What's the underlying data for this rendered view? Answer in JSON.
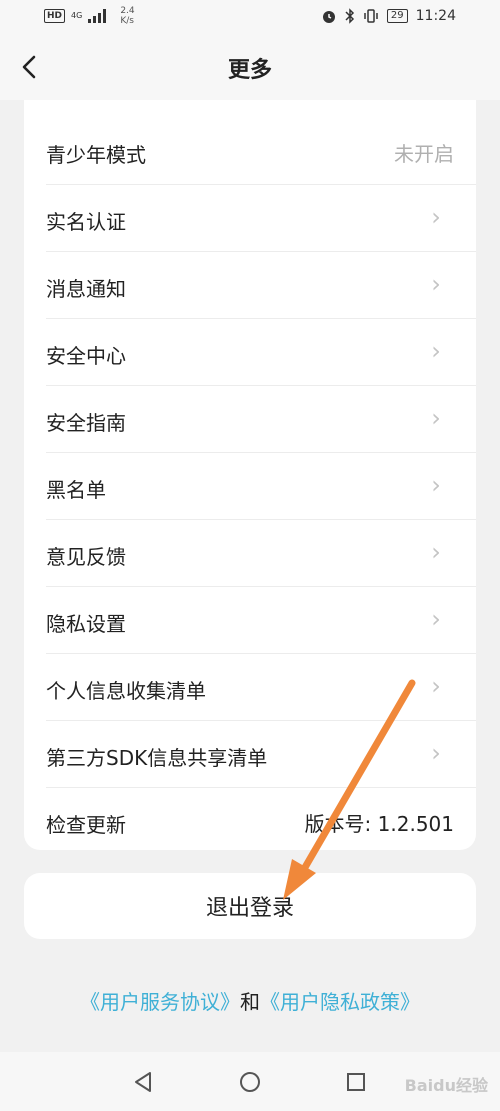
{
  "status_bar": {
    "network_type": "4G",
    "hd_badge": "HD",
    "speed_value": "2.4",
    "speed_unit": "K/s",
    "battery": "29",
    "time": "11:24"
  },
  "header": {
    "title": "更多"
  },
  "settings": [
    {
      "label": "青少年模式",
      "value": "未开启"
    },
    {
      "label": "实名认证"
    },
    {
      "label": "消息通知"
    },
    {
      "label": "安全中心"
    },
    {
      "label": "安全指南"
    },
    {
      "label": "黑名单"
    },
    {
      "label": "意见反馈"
    },
    {
      "label": "隐私设置"
    },
    {
      "label": "个人信息收集清单"
    },
    {
      "label": "第三方SDK信息共享清单"
    },
    {
      "label": "检查更新",
      "value": "版本号: 1.2.501"
    }
  ],
  "logout": {
    "label": "退出登录"
  },
  "agreements": {
    "service_link": "《用户服务协议》",
    "conjunction": "和",
    "privacy_link": "《用户隐私政策》"
  },
  "watermark": "Baidu经验",
  "colors": {
    "link": "#3fb0d6",
    "annotation_arrow": "#f0883a",
    "background": "#f1f1f1"
  }
}
